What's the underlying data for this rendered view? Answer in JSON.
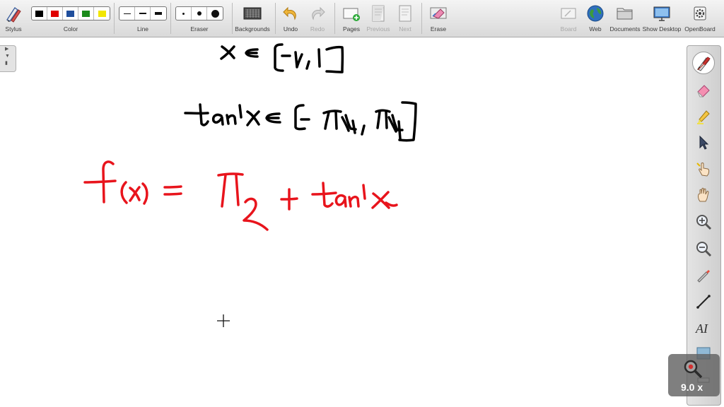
{
  "toolbar": {
    "stylus_label": "Stylus",
    "color_label": "Color",
    "line_label": "Line",
    "eraser_label": "Eraser",
    "backgrounds_label": "Backgrounds",
    "undo_label": "Undo",
    "redo_label": "Redo",
    "pages_label": "Pages",
    "previous_label": "Previous",
    "next_label": "Next",
    "erase_label": "Erase",
    "board_label": "Board",
    "web_label": "Web",
    "documents_label": "Documents",
    "show_desktop_label": "Show Desktop",
    "openboard_label": "OpenBoard"
  },
  "colors": {
    "swatches": [
      "#000000",
      "#e00000",
      "#1f4e9c",
      "#1a8a1a",
      "#f2e600"
    ],
    "ink_black": "#000000",
    "ink_red": "#e8141c"
  },
  "sidebar": {
    "tools": [
      "pen-icon",
      "eraser-icon",
      "highlighter-icon",
      "select-pointer-icon",
      "interact-hand-icon",
      "pan-hand-icon",
      "zoom-in-icon",
      "zoom-out-icon",
      "laser-pointer-icon",
      "line-tool-icon",
      "text-tool-icon",
      "capture-icon",
      "more-icon"
    ],
    "selected_tool": "pen-icon"
  },
  "zoom": {
    "level": "9.0 x"
  }
}
